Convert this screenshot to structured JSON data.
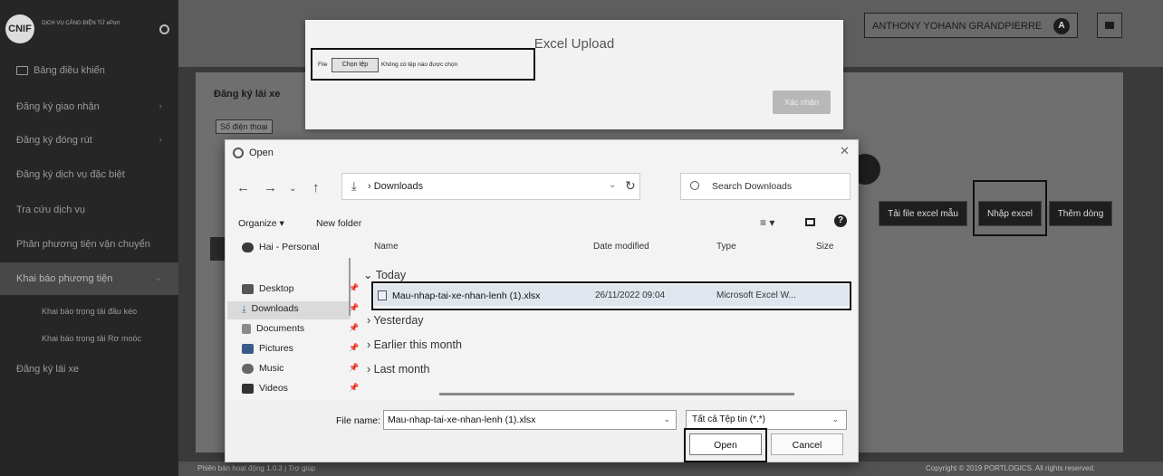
{
  "sidebar": {
    "brand_text": "DỊCH VỤ CẢNG ĐIỆN TỬ ePort",
    "logo_text": "CNIF",
    "items": [
      {
        "label": "Bảng điều khiển"
      },
      {
        "label": "Đăng ký giao nhận"
      },
      {
        "label": "Đăng ký đóng rút"
      },
      {
        "label": "Đăng ký dịch vụ đặc biệt"
      },
      {
        "label": "Tra cứu dịch vụ"
      },
      {
        "label": "Phân phương tiện vận chuyển"
      },
      {
        "label": "Khai báo phương tiện"
      },
      {
        "label": "Đăng ký lái xe"
      }
    ],
    "sub_items": [
      {
        "label": "Khai báo trọng tải đầu kéo"
      },
      {
        "label": "Khai báo trọng tải Rơ moóc"
      }
    ]
  },
  "header": {
    "user_name": "ANTHONY YOHANN GRANDPIERRE",
    "avatar_letter": "A"
  },
  "page": {
    "title": "Đăng ký lái xe",
    "phone_label": "Số điện thoại",
    "buttons": {
      "download_template": "Tải file excel mẫu",
      "import_excel": "Nhập excel",
      "add_new": "Thêm dòng"
    }
  },
  "footer": {
    "left": "Phiên bản hoạt động 1.0.3 | Trợ giúp",
    "right": "Copyright © 2019 PORTLOGICS. All rights reserved."
  },
  "excel_modal": {
    "title": "Excel Upload",
    "file_label": "File",
    "choose_button": "Chọn tệp",
    "no_file_text": "Không có tệp nào được chọn",
    "confirm_button": "Xác nhận"
  },
  "open_dialog": {
    "title": "Open",
    "address": "Downloads",
    "search_placeholder": "Search Downloads",
    "toolbar": {
      "organize": "Organize ▾",
      "new_folder": "New folder"
    },
    "nav_pane": [
      {
        "label": "Hai - Personal",
        "icon": "cloud-icon",
        "pinned": false,
        "color": "#3a3a3a"
      },
      {
        "label": "Desktop",
        "icon": "desktop-icon",
        "pinned": true,
        "color": "#555555"
      },
      {
        "label": "Downloads",
        "icon": "download-icon",
        "pinned": true,
        "color": "#3a6ea5"
      },
      {
        "label": "Documents",
        "icon": "documents-icon",
        "pinned": true,
        "color": "#8a8a8a"
      },
      {
        "label": "Pictures",
        "icon": "pictures-icon",
        "pinned": true,
        "color": "#3a5a8a"
      },
      {
        "label": "Music",
        "icon": "music-icon",
        "pinned": true,
        "color": "#666666"
      },
      {
        "label": "Videos",
        "icon": "videos-icon",
        "pinned": true,
        "color": "#333333"
      }
    ],
    "columns": {
      "name": "Name",
      "date": "Date modified",
      "type": "Type",
      "size": "Size"
    },
    "groups": {
      "today": "Today",
      "yesterday": "Yesterday",
      "earlier": "Earlier this month",
      "last_month": "Last month"
    },
    "file": {
      "name": "Mau-nhap-tai-xe-nhan-lenh (1).xlsx",
      "date": "26/11/2022 09:04",
      "type": "Microsoft Excel W..."
    },
    "file_name_label": "File name:",
    "file_name_value": "Mau-nhap-tai-xe-nhan-lenh (1).xlsx",
    "file_type_value": "Tất cả Tệp tin (*.*)",
    "open_button": "Open",
    "cancel_button": "Cancel"
  }
}
